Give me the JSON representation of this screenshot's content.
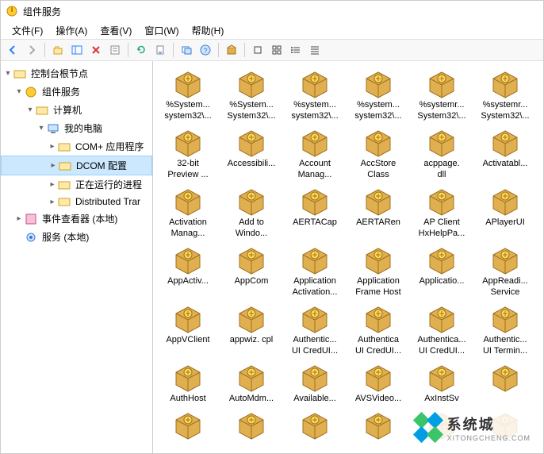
{
  "window": {
    "title": "组件服务"
  },
  "menu": {
    "file": "文件(F)",
    "action": "操作(A)",
    "view": "查看(V)",
    "window": "窗口(W)",
    "help": "帮助(H)"
  },
  "tree": {
    "root": "控制台根节点",
    "comp_svc": "组件服务",
    "computers": "计算机",
    "mycomputer": "我的电脑",
    "com_apps": "COM+ 应用程序",
    "dcom": "DCOM 配置",
    "running": "正在运行的进程",
    "dtc": "Distributed Trar",
    "eventvwr": "事件查看器 (本地)",
    "services": "服务 (本地)"
  },
  "items": [
    {
      "l1": "%System...",
      "l2": "system32\\..."
    },
    {
      "l1": "%System...",
      "l2": "System32\\..."
    },
    {
      "l1": "%system...",
      "l2": "system32\\..."
    },
    {
      "l1": "%system...",
      "l2": "system32\\..."
    },
    {
      "l1": "%systemr...",
      "l2": "System32\\..."
    },
    {
      "l1": "%systemr...",
      "l2": "System32\\..."
    },
    {
      "l1": "32-bit",
      "l2": "Preview ..."
    },
    {
      "l1": "Accessibili...",
      "l2": ""
    },
    {
      "l1": "Account",
      "l2": "Manag..."
    },
    {
      "l1": "AccStore",
      "l2": "Class"
    },
    {
      "l1": "acppage.",
      "l2": "dll"
    },
    {
      "l1": "Activatabl...",
      "l2": ""
    },
    {
      "l1": "Activation",
      "l2": "Manag..."
    },
    {
      "l1": "Add to",
      "l2": "Windo..."
    },
    {
      "l1": "AERTACap",
      "l2": ""
    },
    {
      "l1": "AERTARen",
      "l2": ""
    },
    {
      "l1": "AP Client",
      "l2": "HxHelpPa..."
    },
    {
      "l1": "APlayerUI",
      "l2": ""
    },
    {
      "l1": "AppActiv...",
      "l2": ""
    },
    {
      "l1": "AppCom",
      "l2": ""
    },
    {
      "l1": "Application",
      "l2": "Activation..."
    },
    {
      "l1": "Application",
      "l2": "Frame Host"
    },
    {
      "l1": "Applicatio...",
      "l2": ""
    },
    {
      "l1": "AppReadi...",
      "l2": "Service"
    },
    {
      "l1": "AppVClient",
      "l2": ""
    },
    {
      "l1": "appwiz. cpl",
      "l2": ""
    },
    {
      "l1": "Authentic...",
      "l2": "UI CredUI..."
    },
    {
      "l1": "Authentica",
      "l2": "UI CredUI..."
    },
    {
      "l1": "Authentica...",
      "l2": "UI CredUI..."
    },
    {
      "l1": "Authentic...",
      "l2": "UI Termin..."
    },
    {
      "l1": "AuthHost",
      "l2": ""
    },
    {
      "l1": "AutoMdm...",
      "l2": ""
    },
    {
      "l1": "Available...",
      "l2": ""
    },
    {
      "l1": "AVSVideo...",
      "l2": ""
    },
    {
      "l1": "AxInstSv",
      "l2": ""
    },
    {
      "l1": "",
      "l2": ""
    },
    {
      "l1": "",
      "l2": ""
    },
    {
      "l1": "",
      "l2": ""
    },
    {
      "l1": "",
      "l2": ""
    },
    {
      "l1": "",
      "l2": ""
    },
    {
      "l1": "",
      "l2": ""
    },
    {
      "l1": "",
      "l2": ""
    }
  ],
  "watermark": {
    "text1": "系统城",
    "text2": "XITONGCHENG.COM"
  },
  "colors": {
    "accent": "#2a7fff",
    "brand1": "#3ac569",
    "brand2": "#009fe3"
  }
}
